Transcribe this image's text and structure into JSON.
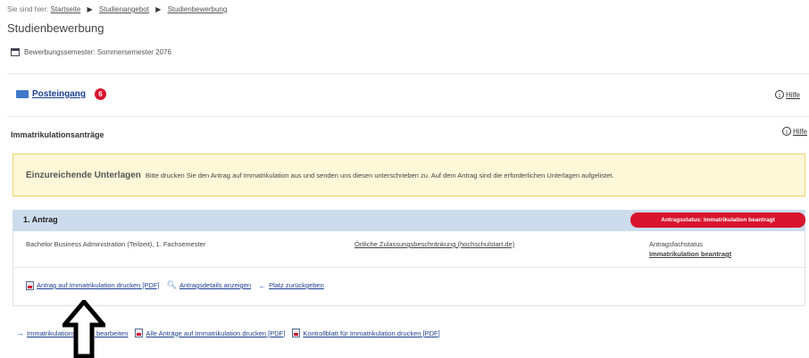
{
  "breadcrumb": {
    "prefix": "Sie sind hier:",
    "items": [
      "Startseite",
      "Studienangebot",
      "Studienbewerbung"
    ]
  },
  "page_title": "Studienbewerbung",
  "semester": {
    "label": "Bewerbungssemester: Sommersemester 2076",
    "icon": "calendar-icon"
  },
  "inbox": {
    "label": "Posteingang",
    "count": "6",
    "icon": "mail-icon"
  },
  "help_label": "Hilfe",
  "applications": {
    "title": "Immatrikulationsanträge",
    "help_label": "Hilfe",
    "notice": {
      "title": "Einzureichende Unterlagen",
      "text": "Bitte drucken Sie den Antrag auf Immatrikulation aus und senden uns diesen unterschrieben zu. Auf dem Antrag sind die erforderlichen Unterlagen aufgelistet."
    },
    "antrag": {
      "title": "1. Antrag",
      "status_badge": "Antragsstatus: Immatrikulation beantragt",
      "program": "Bachelor Business Administration (Teilzeit), 1. Fachsemester",
      "restriction_link": "Örtliche Zulassungsbeschränkung (hochschulstart.de)",
      "subject_status_label": "Antragsfachstatus",
      "subject_status_value": "Immatrikulation beantragt",
      "actions": [
        {
          "label": "Antrag auf Immatrikulation drucken [PDF]",
          "icon": "pdf-icon"
        },
        {
          "label": "Antragsdetails anzeigen",
          "icon": "search-icon"
        },
        {
          "label": "Platz zurückgeben",
          "icon": "arrow-left-icon"
        }
      ]
    }
  },
  "bottom_links": [
    {
      "label": "Immatrikulationsantrag bearbeiten",
      "icon": "arrow-right-icon"
    },
    {
      "label": "Alle Anträge auf Immatrikulation drucken [PDF]",
      "icon": "pdf-icon"
    },
    {
      "label": "Kontrollblatt für Immatrikulation drucken [PDF]",
      "icon": "pdf-icon"
    }
  ],
  "colors": {
    "accent_red": "#d8142e",
    "link_blue": "#1b3f8f",
    "notice_bg": "#fff8d8",
    "header_bg": "#ccdcec"
  }
}
